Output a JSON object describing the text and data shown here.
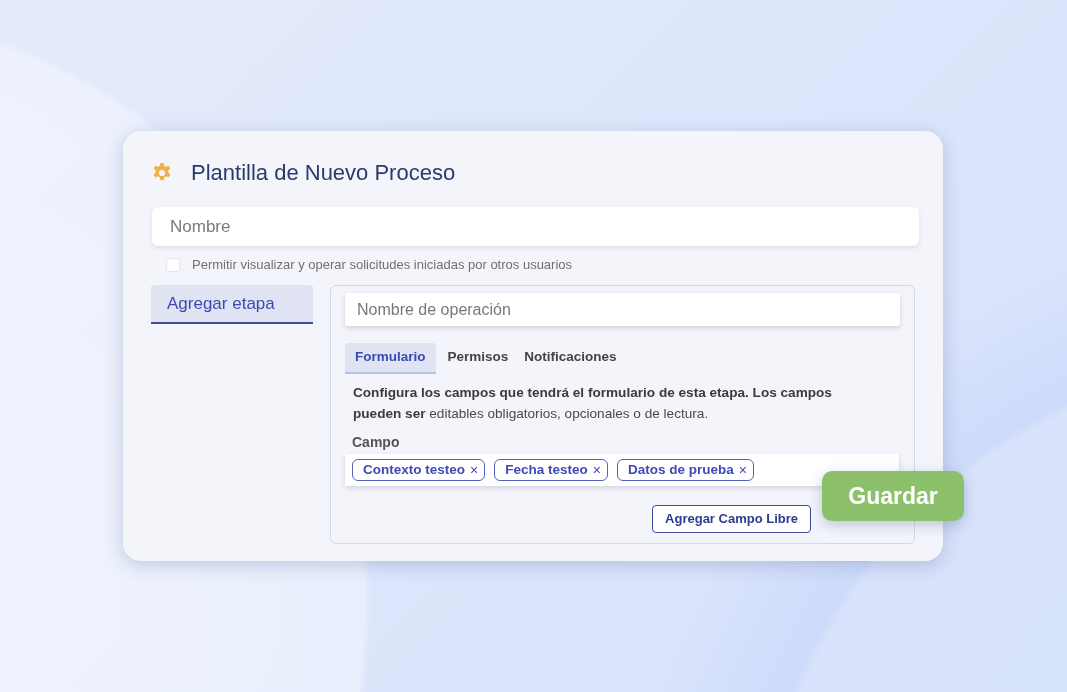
{
  "dialog": {
    "title": "Plantilla de Nuevo Proceso"
  },
  "name_field": {
    "placeholder": "Nombre"
  },
  "share_option": {
    "label": "Permitir visualizar y operar solicitudes iniciadas por otros usuarios",
    "checked": false
  },
  "stage_tabs": [
    {
      "label": "Agregar etapa",
      "selected": true
    }
  ],
  "stage_panel": {
    "operation_field": {
      "placeholder": "Nombre de operación"
    },
    "tabs": [
      {
        "label": "Formulario",
        "selected": true
      },
      {
        "label": "Permisos",
        "selected": false
      },
      {
        "label": "Notificaciones",
        "selected": false
      }
    ],
    "description": "**Configura los campos que tendrá el formulario de esta etapa. Los campos pueden ser** editables obligatorios, opcionales o de lectura.",
    "field_label": "Campo",
    "tags": [
      {
        "label": "Contexto testeo",
        "remove": "×"
      },
      {
        "label": "Fecha testeo",
        "remove": "×"
      },
      {
        "label": "Datos de prueba",
        "remove": "×"
      }
    ],
    "add_button": "Agregar Campo Libre"
  },
  "save_button": "Guardar"
}
